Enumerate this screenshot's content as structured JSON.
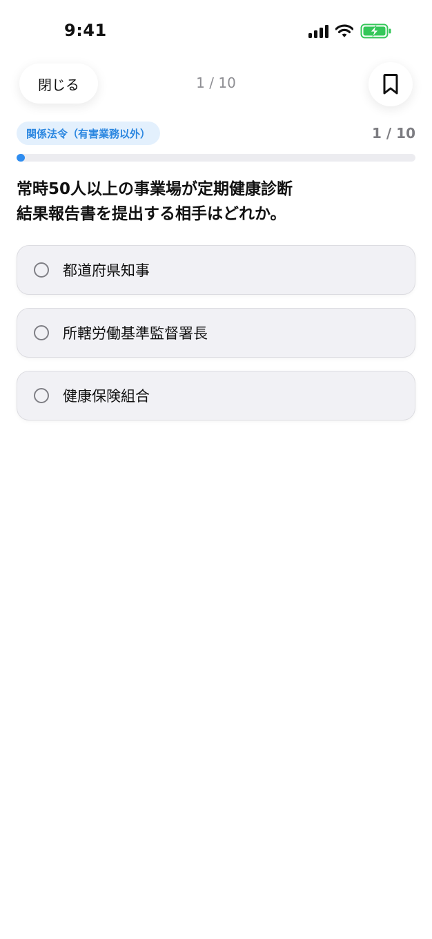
{
  "status_bar": {
    "time": "9:41",
    "icons": [
      "signal-icon",
      "wifi-icon",
      "battery-charging-icon"
    ],
    "battery_color": "#34c759"
  },
  "top_bar": {
    "close_label": "閉じる",
    "progress_text": "1 / 10",
    "bookmark_icon": "bookmark-icon"
  },
  "quiz": {
    "category": "関係法令（有害業務以外）",
    "counter": "1 / 10",
    "progress_fraction": 0.1,
    "question": "常時50人以上の事業場が定期健康診断\n結果報告書を提出する相手はどれか。",
    "options": [
      {
        "label": "都道府県知事"
      },
      {
        "label": "所轄労働基準監督署長"
      },
      {
        "label": "健康保険組合"
      }
    ]
  },
  "colors": {
    "accent": "#2f8df0",
    "badge_bg": "#e3f0fd",
    "badge_text": "#2a86e0",
    "option_bg": "#f1f1f5"
  }
}
